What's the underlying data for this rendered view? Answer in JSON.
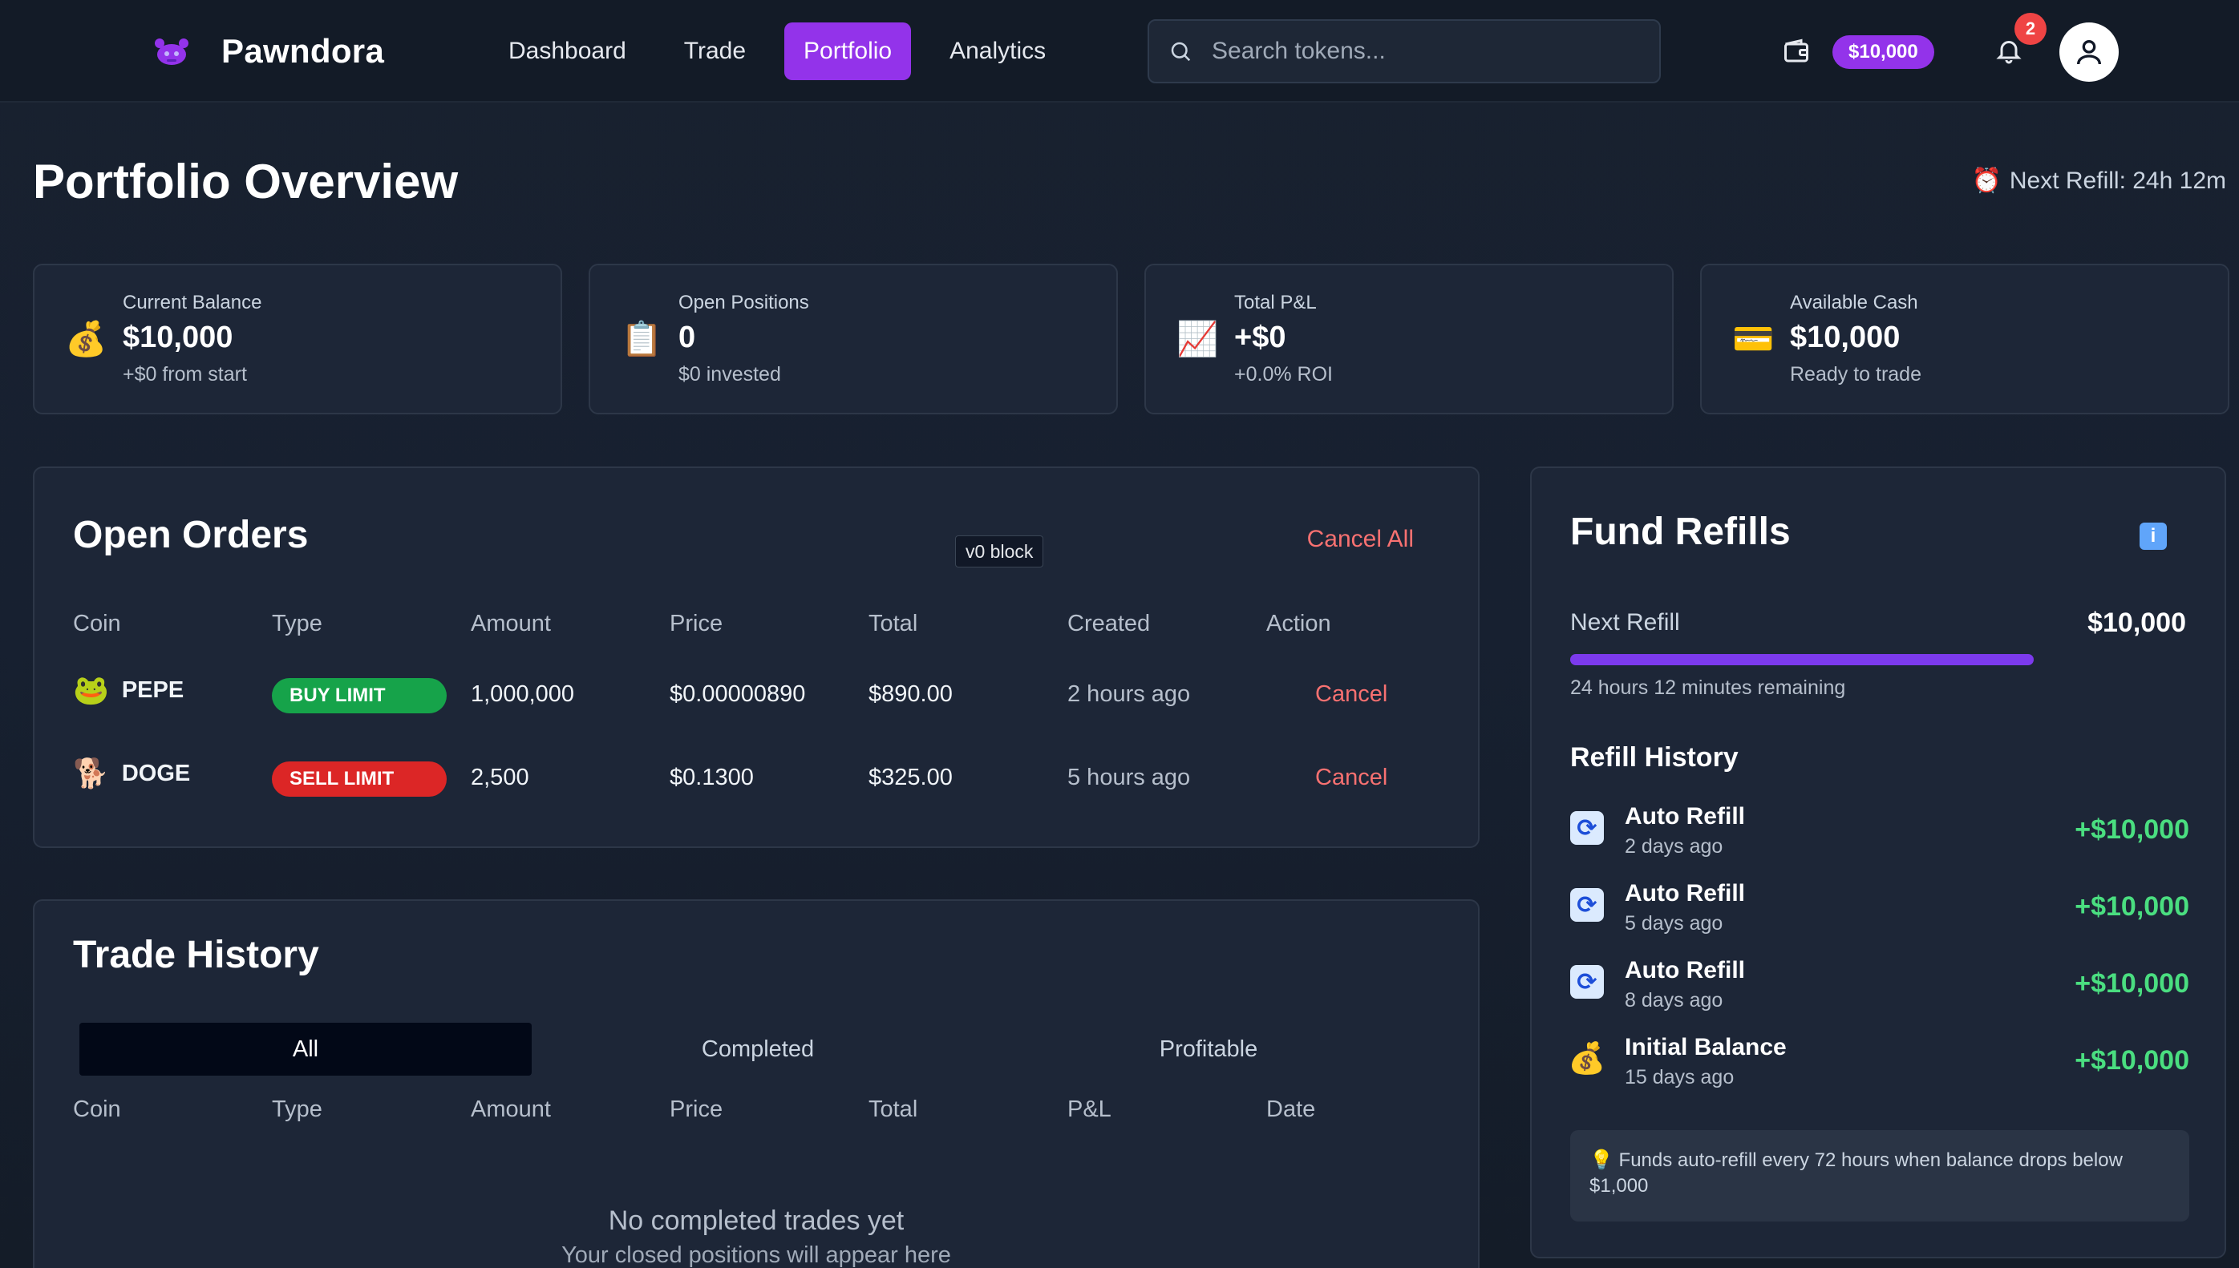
{
  "app": {
    "name": "Pawndora",
    "nav": [
      {
        "label": "Dashboard",
        "active": false
      },
      {
        "label": "Trade",
        "active": false
      },
      {
        "label": "Portfolio",
        "active": true
      },
      {
        "label": "Analytics",
        "active": false
      }
    ],
    "search_placeholder": "Search tokens...",
    "balance_pill": "$10,000",
    "notification_count": "2",
    "icons": {
      "logo": "paw-logo-icon",
      "search": "search-icon",
      "wallet": "wallet-icon",
      "bell": "bell-icon",
      "user": "user-icon"
    }
  },
  "page": {
    "title": "Portfolio Overview",
    "next_refill": "Next Refill: 24h 12m",
    "next_refill_icon": "⏰"
  },
  "stats": [
    {
      "icon": "💰",
      "label": "Current Balance",
      "value": "$10,000",
      "sub": "+$0 from start"
    },
    {
      "icon": "📋",
      "label": "Open Positions",
      "value": "0",
      "sub": "$0 invested"
    },
    {
      "icon": "📈",
      "label": "Total P&L",
      "value": "+$0",
      "sub": "+0.0% ROI"
    },
    {
      "icon": "💳",
      "label": "Available Cash",
      "value": "$10,000",
      "sub": "Ready to trade"
    }
  ],
  "open_orders": {
    "title": "Open Orders",
    "tooltip": "v0 block",
    "cancel_all": "Cancel All",
    "columns": [
      "Coin",
      "Type",
      "Amount",
      "Price",
      "Total",
      "Created",
      "Action"
    ],
    "rows": [
      {
        "emoji": "🐸",
        "coin": "PEPE",
        "type": "BUY LIMIT",
        "side": "buy",
        "amount": "1,000,000",
        "price": "$0.00000890",
        "total": "$890.00",
        "created": "2 hours ago",
        "action": "Cancel"
      },
      {
        "emoji": "🐕",
        "coin": "DOGE",
        "type": "SELL LIMIT",
        "side": "sell",
        "amount": "2,500",
        "price": "$0.1300",
        "total": "$325.00",
        "created": "5 hours ago",
        "action": "Cancel"
      }
    ]
  },
  "trade_history": {
    "title": "Trade History",
    "tabs": [
      {
        "label": "All",
        "active": true
      },
      {
        "label": "Completed",
        "active": false
      },
      {
        "label": "Profitable",
        "active": false
      }
    ],
    "columns": [
      "Coin",
      "Type",
      "Amount",
      "Price",
      "Total",
      "P&L",
      "Date"
    ],
    "empty_title": "No completed trades yet",
    "empty_sub": "Your closed positions will appear here"
  },
  "fund_refills": {
    "title": "Fund Refills",
    "info_icon": "i",
    "next_refill_label": "Next Refill",
    "next_refill_amount": "$10,000",
    "progress_fraction": 0.75,
    "remaining": "24 hours 12 minutes remaining",
    "history_title": "Refill History",
    "history": [
      {
        "icon": "refresh",
        "name": "Auto Refill",
        "when": "2 days ago",
        "amount": "+$10,000"
      },
      {
        "icon": "refresh",
        "name": "Auto Refill",
        "when": "5 days ago",
        "amount": "+$10,000"
      },
      {
        "icon": "refresh",
        "name": "Auto Refill",
        "when": "8 days ago",
        "amount": "+$10,000"
      },
      {
        "icon": "money",
        "name": "Initial Balance",
        "when": "15 days ago",
        "amount": "+$10,000"
      }
    ],
    "note": "💡 Funds auto-refill every 72 hours when balance drops below $1,000"
  }
}
